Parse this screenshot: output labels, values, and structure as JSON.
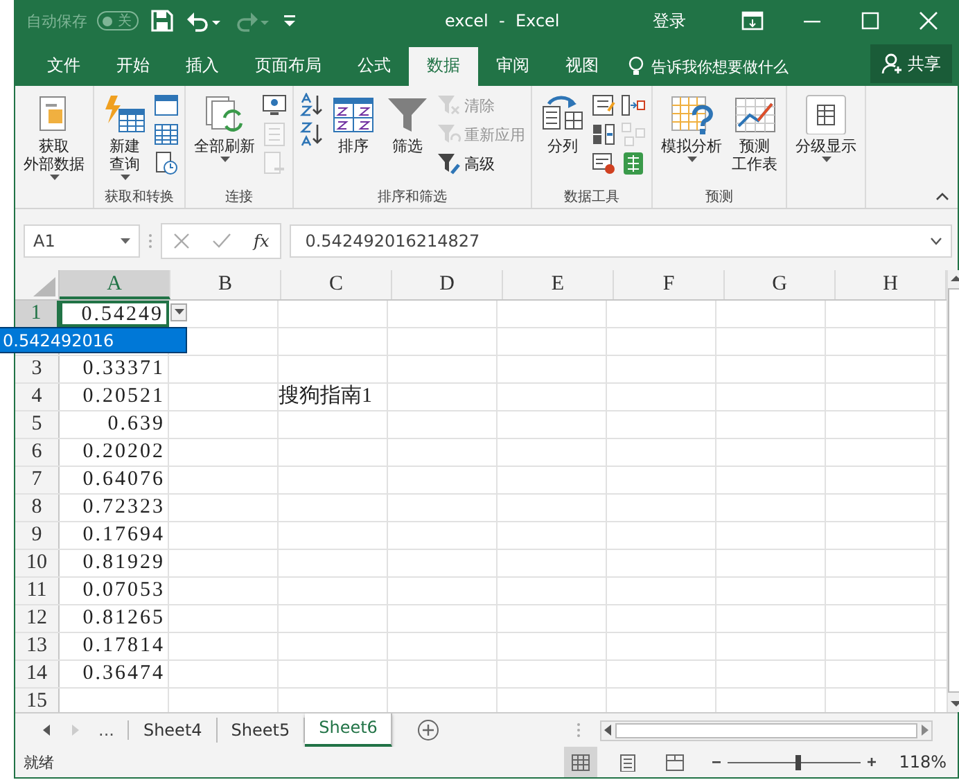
{
  "title_bar": {
    "autosave": {
      "label": "自动保存",
      "toggle_text": "关",
      "on": false
    },
    "title": "excel  -  Excel",
    "login": "登录"
  },
  "menu_tabs": [
    {
      "label": "文件",
      "selected": false
    },
    {
      "label": "开始",
      "selected": false
    },
    {
      "label": "插入",
      "selected": false
    },
    {
      "label": "页面布局",
      "selected": false
    },
    {
      "label": "公式",
      "selected": false
    },
    {
      "label": "数据",
      "selected": true
    },
    {
      "label": "审阅",
      "selected": false
    },
    {
      "label": "视图",
      "selected": false
    }
  ],
  "tell_me": "告诉我你想要做什么",
  "share": "共享",
  "ribbon": {
    "groups": [
      {
        "columns": [
          {
            "kind": "large",
            "lines": [
              "获取",
              "外部数据"
            ],
            "dropdown": true
          }
        ]
      },
      {
        "label": "获取和转换",
        "columns": [
          {
            "kind": "large",
            "lines": [
              "新建",
              "查询"
            ],
            "dropdown": true
          },
          {
            "kind": "stack",
            "items": [
              {
                "disabled": false
              },
              {
                "disabled": false
              },
              {
                "disabled": false
              }
            ]
          }
        ]
      },
      {
        "label": "连接",
        "columns": [
          {
            "kind": "large",
            "lines": [
              "全部刷新"
            ],
            "dropdown": true
          },
          {
            "kind": "stack",
            "items": [
              {
                "disabled": false
              },
              {
                "disabled": true
              },
              {
                "disabled": true
              }
            ]
          }
        ]
      },
      {
        "label": "排序和筛选",
        "columns": [
          {
            "kind": "stack",
            "items": [
              {
                "disabled": false
              },
              {
                "disabled": false
              }
            ]
          },
          {
            "kind": "large",
            "lines": [
              "排序"
            ],
            "dropdown": false
          },
          {
            "kind": "large",
            "lines": [
              "筛选"
            ],
            "dropdown": false
          },
          {
            "kind": "stack",
            "items": [
              {
                "label": "清除",
                "disabled": true
              },
              {
                "label": "重新应用",
                "disabled": true
              },
              {
                "label": "高级",
                "disabled": false
              }
            ]
          }
        ]
      },
      {
        "label": "数据工具",
        "columns": [
          {
            "kind": "large",
            "lines": [
              "分列"
            ],
            "dropdown": false
          },
          {
            "kind": "stack",
            "items": [
              {
                "disabled": false
              },
              {
                "disabled": false
              },
              {
                "disabled": false
              }
            ]
          },
          {
            "kind": "stack",
            "items": [
              {
                "disabled": false
              },
              {
                "disabled": true
              },
              {
                "disabled": false
              }
            ]
          }
        ]
      },
      {
        "label": "预测",
        "columns": [
          {
            "kind": "large",
            "lines": [
              "模拟分析"
            ],
            "dropdown": true
          },
          {
            "kind": "large",
            "lines": [
              "预测",
              "工作表"
            ],
            "dropdown": false
          }
        ]
      },
      {
        "columns": [
          {
            "kind": "large",
            "lines": [
              "分级显示"
            ],
            "dropdown": true
          }
        ]
      }
    ]
  },
  "formula_bar": {
    "name_box": "A1",
    "fx": "fx",
    "value": "0.542492016214827"
  },
  "sheet": {
    "columns": [
      {
        "label": "A",
        "selected": true
      },
      {
        "label": "B",
        "selected": false
      },
      {
        "label": "C",
        "selected": false
      },
      {
        "label": "D",
        "selected": false
      },
      {
        "label": "E",
        "selected": false
      },
      {
        "label": "F",
        "selected": false
      },
      {
        "label": "G",
        "selected": false
      },
      {
        "label": "H",
        "selected": false
      }
    ],
    "rows": [
      {
        "kind": "row",
        "number": "1",
        "selected": true,
        "a": "0.54249"
      },
      {
        "kind": "covered"
      },
      {
        "kind": "row",
        "number": "3",
        "selected": false,
        "a": "0.33371"
      },
      {
        "kind": "row",
        "number": "4",
        "selected": false,
        "a": "0.20521",
        "c": "搜狗指南1"
      },
      {
        "kind": "row",
        "number": "5",
        "selected": false,
        "a": "0.639"
      },
      {
        "kind": "row",
        "number": "6",
        "selected": false,
        "a": "0.20202"
      },
      {
        "kind": "row",
        "number": "7",
        "selected": false,
        "a": "0.64076"
      },
      {
        "kind": "row",
        "number": "8",
        "selected": false,
        "a": "0.72323"
      },
      {
        "kind": "row",
        "number": "9",
        "selected": false,
        "a": "0.17694"
      },
      {
        "kind": "row",
        "number": "10",
        "selected": false,
        "a": "0.81929"
      },
      {
        "kind": "row",
        "number": "11",
        "selected": false,
        "a": "0.07053"
      },
      {
        "kind": "row",
        "number": "12",
        "selected": false,
        "a": "0.81265"
      },
      {
        "kind": "row",
        "number": "13",
        "selected": false,
        "a": "0.17814"
      },
      {
        "kind": "row",
        "number": "14",
        "selected": false,
        "a": "0.36474"
      },
      {
        "kind": "row",
        "number": "15",
        "selected": false
      }
    ],
    "autocomplete": "0.542492016"
  },
  "sheet_tabs": {
    "more": "...",
    "tabs": [
      {
        "label": "Sheet4",
        "selected": false
      },
      {
        "label": "Sheet5",
        "selected": false
      },
      {
        "label": "Sheet6",
        "selected": true
      }
    ]
  },
  "status_bar": {
    "status": "就绪",
    "views": [
      {
        "selected": true
      },
      {
        "selected": false
      },
      {
        "selected": false
      }
    ],
    "zoom": {
      "level": 0.53,
      "reading": "118%"
    }
  }
}
